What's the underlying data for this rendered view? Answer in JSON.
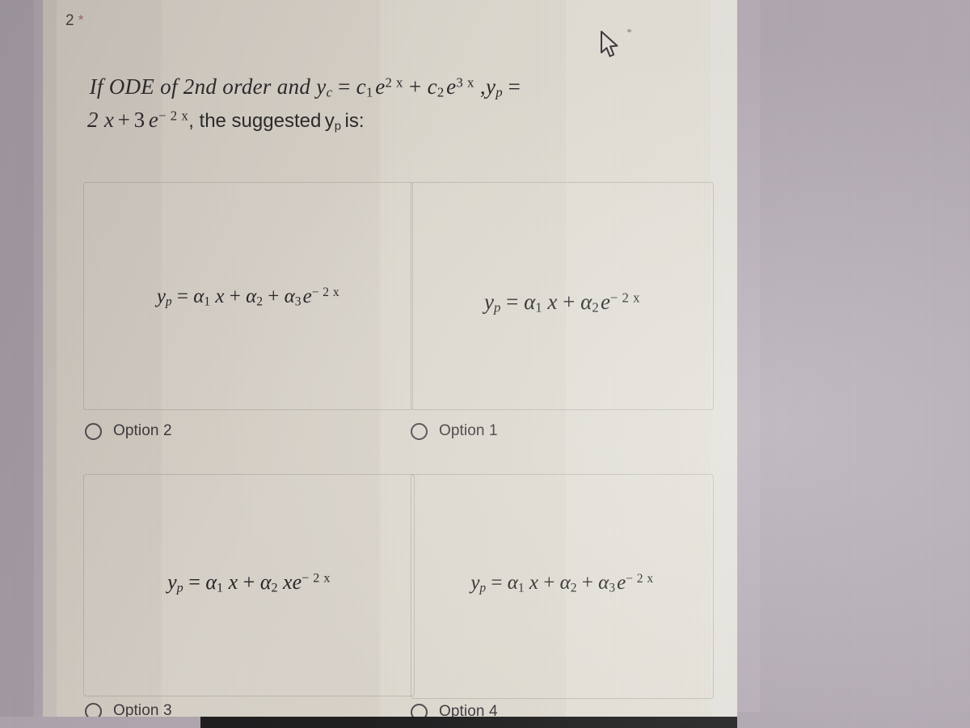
{
  "page": {
    "question_number": "2",
    "required_marker": "*",
    "background_color": "#ddd8ce",
    "surround_color": "#b1a8b2",
    "accent_color": "#a3626a"
  },
  "question": {
    "line1": {
      "intro": "If ODE of 2nd order and",
      "yc_var": "y",
      "yc_sub": "c",
      "equals": "=",
      "term1_coeff": "c",
      "term1_sub": "1",
      "term1_base": "e",
      "term1_exp": "2 x",
      "plus": "+",
      "term2_coeff": "c",
      "term2_sub": "2",
      "term2_base": "e",
      "term2_exp": "3 x",
      "comma": ",",
      "yp_var": "y",
      "yp_sub": "p",
      "equals2": "="
    },
    "line2": {
      "rhs_a": "2 x",
      "plus": "+",
      "rhs_b": "3",
      "rhs_base": "e",
      "rhs_exp": "− 2 x",
      "tail": ", the suggested",
      "yp_var": "y",
      "yp_sub": "p",
      "tail2": "is:"
    }
  },
  "options": [
    {
      "id": "a",
      "label": "Option 2",
      "icon": "radio-unselected-icon",
      "selected": false,
      "formula": {
        "lhs_var": "y",
        "lhs_sub": "p",
        "equals": "=",
        "t1_coeff": "α",
        "t1_sub": "1",
        "t1_x": "x",
        "op1": "+",
        "t2_coeff": "α",
        "t2_sub": "2",
        "op2": "+",
        "t3_coeff": "α",
        "t3_sub": "3",
        "t3_base": "e",
        "t3_exp": "− 2 x"
      },
      "formula_text": "yₚ = α₁ x + α₂ + α₃ e⁻²ˣ"
    },
    {
      "id": "b",
      "label": "Option 1",
      "icon": "radio-unselected-icon",
      "selected": false,
      "formula": {
        "lhs_var": "y",
        "lhs_sub": "p",
        "equals": "=",
        "t1_coeff": "α",
        "t1_sub": "1",
        "t1_x": "x",
        "op1": "+",
        "t2_coeff": "α",
        "t2_sub": "2",
        "t2_base": "e",
        "t2_exp": "− 2 x"
      },
      "formula_text": "yₚ = α₁ x + α₂ e⁻²ˣ"
    },
    {
      "id": "c",
      "label": "Option 3",
      "icon": "radio-unselected-icon",
      "selected": false,
      "formula": {
        "lhs_var": "y",
        "lhs_sub": "p",
        "equals": "=",
        "t1_coeff": "α",
        "t1_sub": "1",
        "t1_x": "x",
        "op1": "+",
        "t2_coeff": "α",
        "t2_sub": "2",
        "t2_x": "x",
        "t2_base": "e",
        "t2_exp": "− 2 x"
      },
      "formula_text": "yₚ = α₁ x + α₂ x e⁻²ˣ"
    },
    {
      "id": "d",
      "label": "Option 4",
      "icon": "radio-unselected-icon",
      "selected": false,
      "formula": {
        "lhs_var": "y",
        "lhs_sub": "p",
        "equals": "=",
        "t1_coeff": "α",
        "t1_sub": "1",
        "t1_x": "x",
        "op1": "+",
        "t2_coeff": "α",
        "t2_sub": "2",
        "op2": "+",
        "t3_coeff": "α",
        "t3_sub": "3",
        "t3_base": "e",
        "t3_exp": "− 2 x"
      },
      "formula_text": "yₚ = α₁ x + α₂ + α₃ e⁻²ˣ"
    }
  ],
  "cursor": {
    "icon": "mouse-pointer-icon"
  }
}
